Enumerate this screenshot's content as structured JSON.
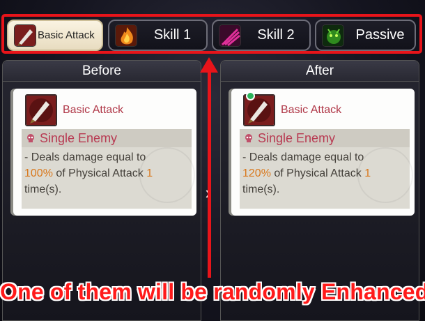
{
  "tabs": [
    {
      "label": "Basic Attack",
      "icon": "dagger-icon",
      "active": true
    },
    {
      "label": "Skill 1",
      "icon": "fire-icon",
      "active": false
    },
    {
      "label": "Skill 2",
      "icon": "claw-icon",
      "active": false
    },
    {
      "label": "Passive",
      "icon": "beast-icon",
      "active": false
    }
  ],
  "panels": {
    "before": {
      "header": "Before",
      "skill_name": "Basic Attack",
      "target": "Single Enemy",
      "desc_prefix": "- Deals damage equal to",
      "percent": "100%",
      "desc_middle": " of Physical Attack ",
      "hits": "1",
      "hits_suffix": "time(s)",
      "period": "."
    },
    "after": {
      "header": "After",
      "skill_name": "Basic Attack",
      "target": "Single Enemy",
      "desc_prefix": "- Deals damage equal to",
      "percent": "120%",
      "desc_middle": " of Physical Attack ",
      "hits": "1",
      "hits_suffix": "time(s)",
      "period": "."
    }
  },
  "compare_arrow": "›",
  "caption": "One of them will be randomly Enhanced",
  "colors": {
    "highlight": "#e8141a",
    "skill_name": "#b03848",
    "value_highlight": "#d9781c",
    "new_badge": "#2cb35a"
  }
}
